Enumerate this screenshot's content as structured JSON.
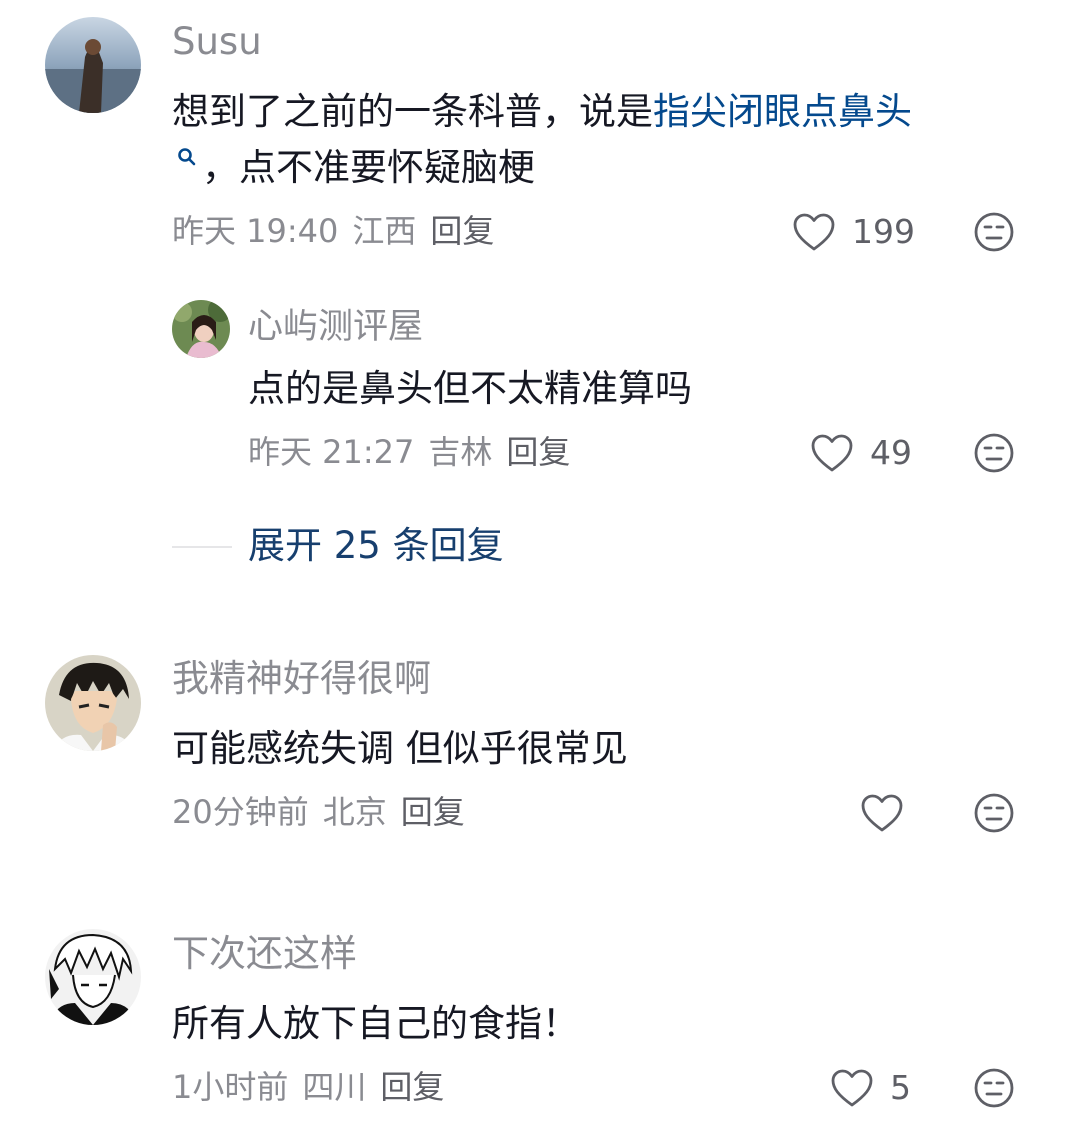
{
  "comments": [
    {
      "username": "Susu",
      "text_before": "想到了之前的一条科普，说是",
      "link_text": "指尖闭眼点鼻头",
      "text_after": "，点不准要怀疑脑梗",
      "time": "昨天 19:40",
      "location": "江西",
      "reply_label": "回复",
      "likes": "199",
      "reply": {
        "username": "心屿测评屋",
        "text": "点的是鼻头但不太精准算吗",
        "time": "昨天 21:27",
        "location": "吉林",
        "reply_label": "回复",
        "likes": "49"
      },
      "expand_label": "展开 25 条回复"
    },
    {
      "username": "我精神好得很啊",
      "text": "可能感统失调 但似乎很常见",
      "time": "20分钟前",
      "location": "北京",
      "reply_label": "回复",
      "likes": ""
    },
    {
      "username": "下次还这样",
      "text": "所有人放下自己的食指！",
      "time": "1小时前",
      "location": "四川",
      "reply_label": "回复",
      "likes": "5"
    }
  ],
  "icons": {
    "like": "heart-outline-icon",
    "dislike": "neutral-face-icon",
    "search": "search-icon"
  },
  "colors": {
    "link": "#04498d",
    "secondary_text": "#8a8b91",
    "primary_text": "#161823"
  }
}
